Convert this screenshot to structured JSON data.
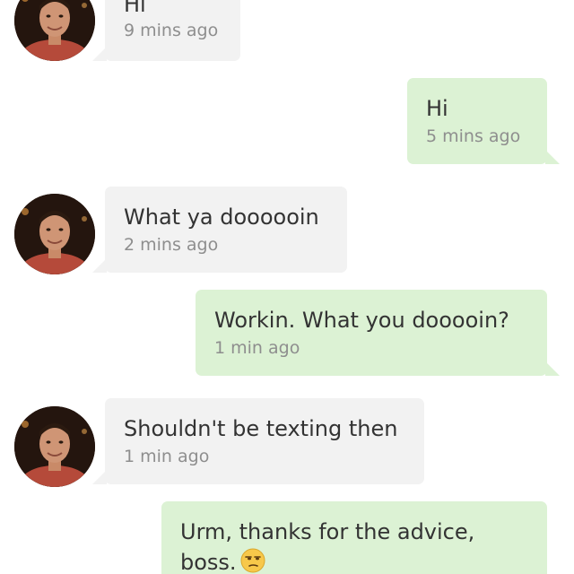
{
  "conversation": {
    "messages": [
      {
        "direction": "incoming",
        "text": "Hi",
        "time": "9 mins ago"
      },
      {
        "direction": "outgoing",
        "text": "Hi",
        "time": "5 mins ago"
      },
      {
        "direction": "incoming",
        "text": "What ya doooooin",
        "time": "2 mins ago"
      },
      {
        "direction": "outgoing",
        "text": "Workin. What you dooooin?",
        "time": "1 min ago"
      },
      {
        "direction": "incoming",
        "text": "Shouldn't be texting then",
        "time": "1 min ago"
      },
      {
        "direction": "outgoing",
        "text": "Urm, thanks for the advice, boss.",
        "emoji": "unamused-face",
        "time": ""
      }
    ]
  },
  "colors": {
    "incoming_bubble": "#f2f2f2",
    "outgoing_bubble": "#dcf2d4",
    "text": "#333333",
    "timestamp": "#8e8e8e"
  },
  "icons": {
    "avatar": "contact-avatar-photo",
    "emoji": "unamused-face"
  }
}
